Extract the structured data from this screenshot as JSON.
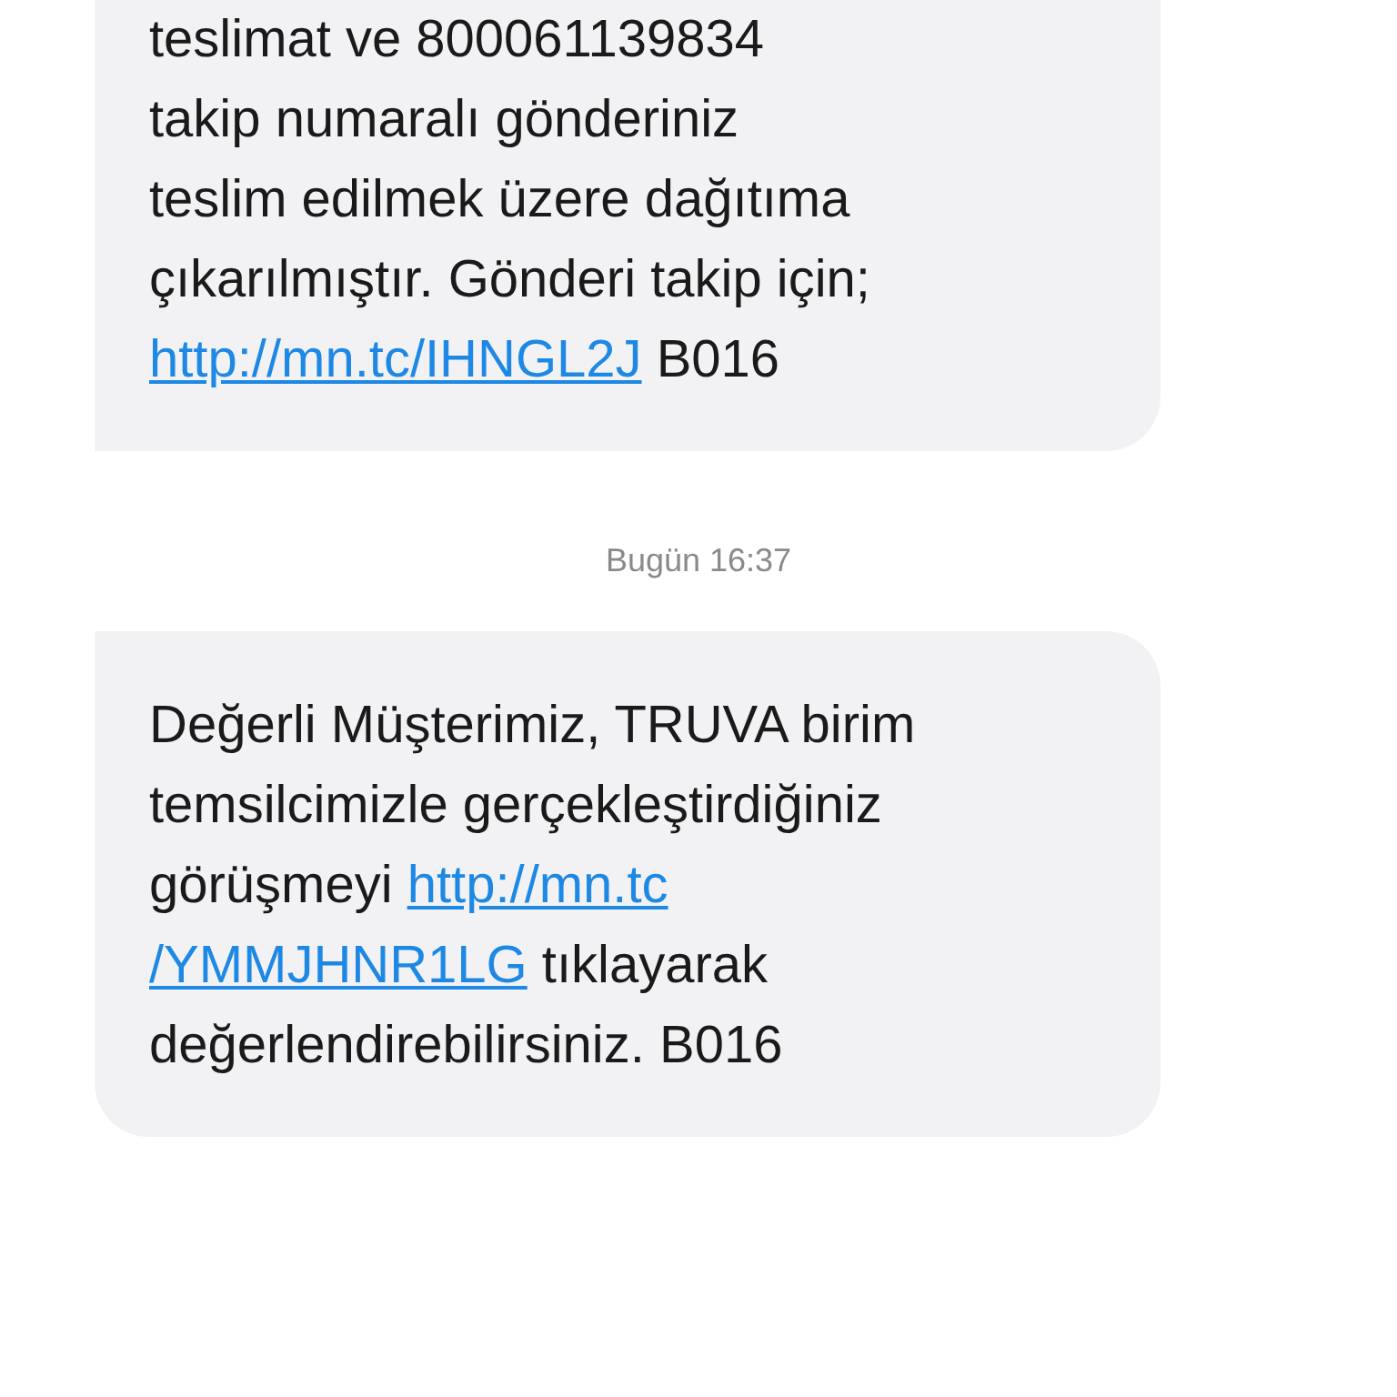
{
  "messages": [
    {
      "kind": "bubble",
      "segments": [
        {
          "kind": "text",
          "text": "teslimat ve 800061139834\ntakip numaralı gönderiniz\nteslim edilmek üzere dağıtıma\nçıkarılmıştır. Gönderi takip için;\n"
        },
        {
          "kind": "link",
          "text": "http://mn.tc/IHNGL2J"
        },
        {
          "kind": "text",
          "text": " B016"
        }
      ]
    },
    {
      "kind": "time",
      "text": "Bugün 16:37"
    },
    {
      "kind": "bubble",
      "segments": [
        {
          "kind": "text",
          "text": "Değerli Müşterimiz, TRUVA birim\ntemsilcimizle gerçekleştirdiğiniz\ngörüşmeyi "
        },
        {
          "kind": "link",
          "text": "http://mn.tc"
        },
        {
          "kind": "break"
        },
        {
          "kind": "link",
          "text": "/YMMJHNR1LG"
        },
        {
          "kind": "text",
          "text": " tıklayarak\ndeğerlendirebilirsiniz. B016"
        }
      ]
    }
  ]
}
